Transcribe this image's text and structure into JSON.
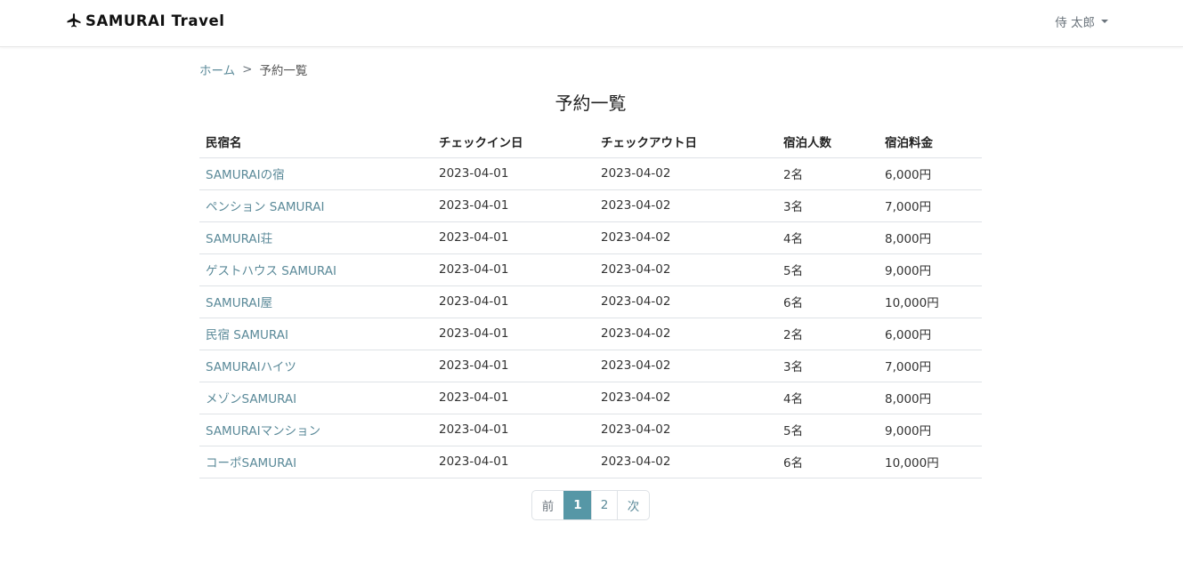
{
  "header": {
    "brand": "SAMURAI Travel",
    "user_name": "侍 太郎"
  },
  "breadcrumb": {
    "home": "ホーム",
    "separator": ">",
    "current": "予約一覧"
  },
  "page_title": "予約一覧",
  "table": {
    "columns": [
      "民宿名",
      "チェックイン日",
      "チェックアウト日",
      "宿泊人数",
      "宿泊料金"
    ],
    "rows": [
      [
        "SAMURAIの宿",
        "2023-04-01",
        "2023-04-02",
        "2名",
        "6,000円"
      ],
      [
        "ペンション SAMURAI",
        "2023-04-01",
        "2023-04-02",
        "3名",
        "7,000円"
      ],
      [
        "SAMURAI荘",
        "2023-04-01",
        "2023-04-02",
        "4名",
        "8,000円"
      ],
      [
        "ゲストハウス SAMURAI",
        "2023-04-01",
        "2023-04-02",
        "5名",
        "9,000円"
      ],
      [
        "SAMURAI屋",
        "2023-04-01",
        "2023-04-02",
        "6名",
        "10,000円"
      ],
      [
        "民宿 SAMURAI",
        "2023-04-01",
        "2023-04-02",
        "2名",
        "6,000円"
      ],
      [
        "SAMURAIハイツ",
        "2023-04-01",
        "2023-04-02",
        "3名",
        "7,000円"
      ],
      [
        "メゾンSAMURAI",
        "2023-04-01",
        "2023-04-02",
        "4名",
        "8,000円"
      ],
      [
        "SAMURAIマンション",
        "2023-04-01",
        "2023-04-02",
        "5名",
        "9,000円"
      ],
      [
        "コーポSAMURAI",
        "2023-04-01",
        "2023-04-02",
        "6名",
        "10,000円"
      ]
    ]
  },
  "pagination": {
    "prev": "前",
    "pages": [
      "1",
      "2"
    ],
    "active_page": "1",
    "next": "次"
  },
  "colors": {
    "link": "#5b8a99",
    "accent": "#5697a6"
  },
  "icons": {
    "brand": "airplane-icon",
    "user_menu": "caret-down-icon"
  }
}
